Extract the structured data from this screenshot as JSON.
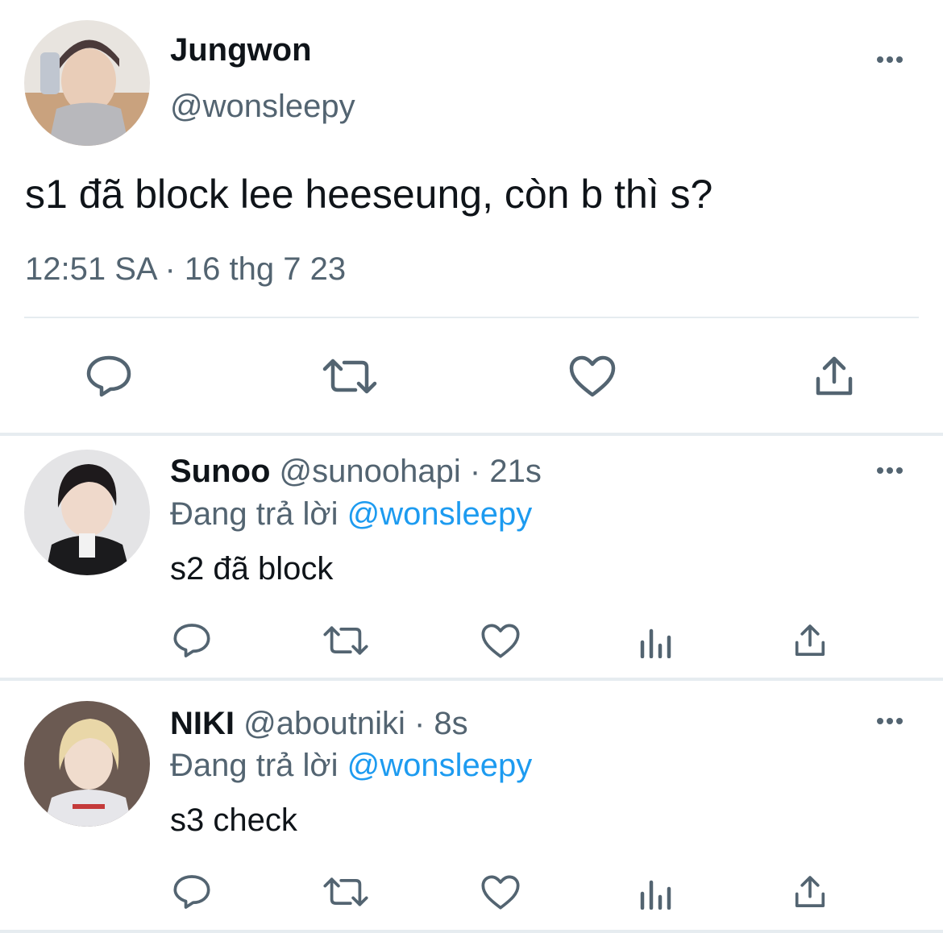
{
  "tweet": {
    "author_name": "Jungwon",
    "author_handle": "@wonsleepy",
    "text": "s1 đã block lee heeseung, còn b thì s?",
    "timestamp": "12:51 SA · 16 thg 7 23",
    "actions": [
      "reply-icon",
      "retweet-icon",
      "like-icon",
      "share-icon"
    ]
  },
  "replies": [
    {
      "name": "Sunoo",
      "handle": "@sunoohapi",
      "time": "· 21s",
      "replying_label": "Đang trả lời",
      "replying_to": "@wonsleepy",
      "text": "s2 đã block"
    },
    {
      "name": "NIKI",
      "handle": "@aboutniki",
      "time": "· 8s",
      "replying_label": "Đang trả lời",
      "replying_to": "@wonsleepy",
      "text": "s3 check"
    }
  ],
  "colors": {
    "text": "#0f1419",
    "secondary": "#536471",
    "link": "#1d9bf0",
    "divider": "#e6ecf0"
  }
}
